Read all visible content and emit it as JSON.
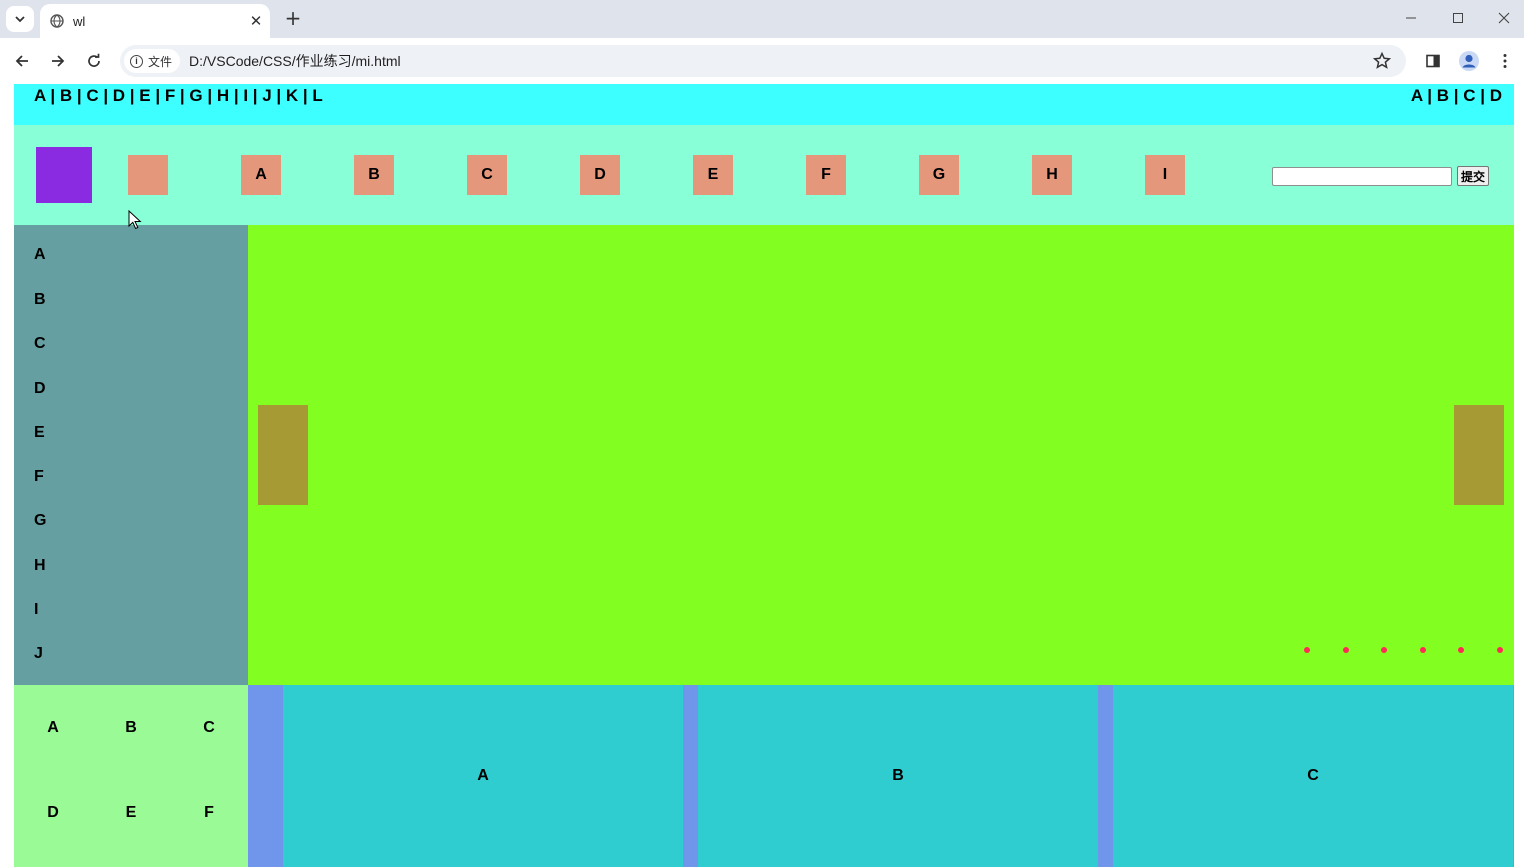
{
  "browser": {
    "tab_title": "wl",
    "site_chip_label": "文件",
    "url": "D:/VSCode/CSS/作业练习/mi.html"
  },
  "topbar": {
    "left_links": "A | B | C | D | E | F | G | H | I | J | K | L",
    "right_links": "A | B | C | D"
  },
  "header": {
    "nav_items": [
      "A",
      "B",
      "C",
      "D",
      "E",
      "F",
      "G",
      "H",
      "I"
    ],
    "search_value": "",
    "submit_label": "提交"
  },
  "sidebar": {
    "items": [
      "A",
      "B",
      "C",
      "D",
      "E",
      "F",
      "G",
      "H",
      "I",
      "J"
    ]
  },
  "banner": {
    "dot_count": 6,
    "colors": {
      "background": "#82ff20",
      "arrow": "#a59a33",
      "dot": "#ff2a55"
    }
  },
  "bottom": {
    "grid_items": [
      "A",
      "B",
      "C",
      "D",
      "E",
      "F"
    ],
    "cards": [
      "A",
      "B",
      "C"
    ]
  }
}
